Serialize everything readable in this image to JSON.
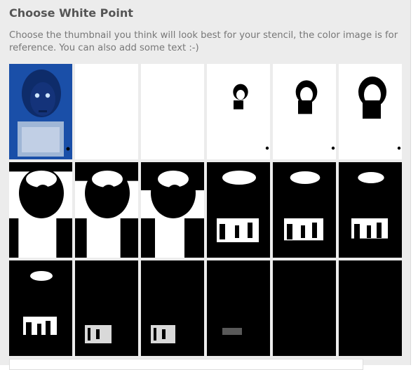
{
  "dialog": {
    "title": "Choose White Point",
    "description": "Choose the thumbnail you think will look best for your stencil, the color image is for reference. You can also add some text :-)"
  },
  "thumbnails": [
    {
      "kind": "reference"
    },
    {
      "kind": "threshold",
      "level": 1
    },
    {
      "kind": "threshold",
      "level": 2
    },
    {
      "kind": "threshold",
      "level": 3
    },
    {
      "kind": "threshold",
      "level": 4
    },
    {
      "kind": "threshold",
      "level": 5
    },
    {
      "kind": "threshold",
      "level": 6
    },
    {
      "kind": "threshold",
      "level": 7
    },
    {
      "kind": "threshold",
      "level": 8
    },
    {
      "kind": "threshold",
      "level": 9
    },
    {
      "kind": "threshold",
      "level": 10
    },
    {
      "kind": "threshold",
      "level": 11
    },
    {
      "kind": "threshold",
      "level": 12
    },
    {
      "kind": "threshold",
      "level": 13
    },
    {
      "kind": "threshold",
      "level": 14
    },
    {
      "kind": "threshold",
      "level": 15
    },
    {
      "kind": "threshold",
      "level": 16
    },
    {
      "kind": "threshold",
      "level": 17
    }
  ],
  "colors": {
    "panel_bg": "#ececec",
    "title": "#555555",
    "text": "#777777",
    "reference_blue": "#1a4fa8",
    "stencil_black": "#000000",
    "stencil_white": "#ffffff"
  }
}
